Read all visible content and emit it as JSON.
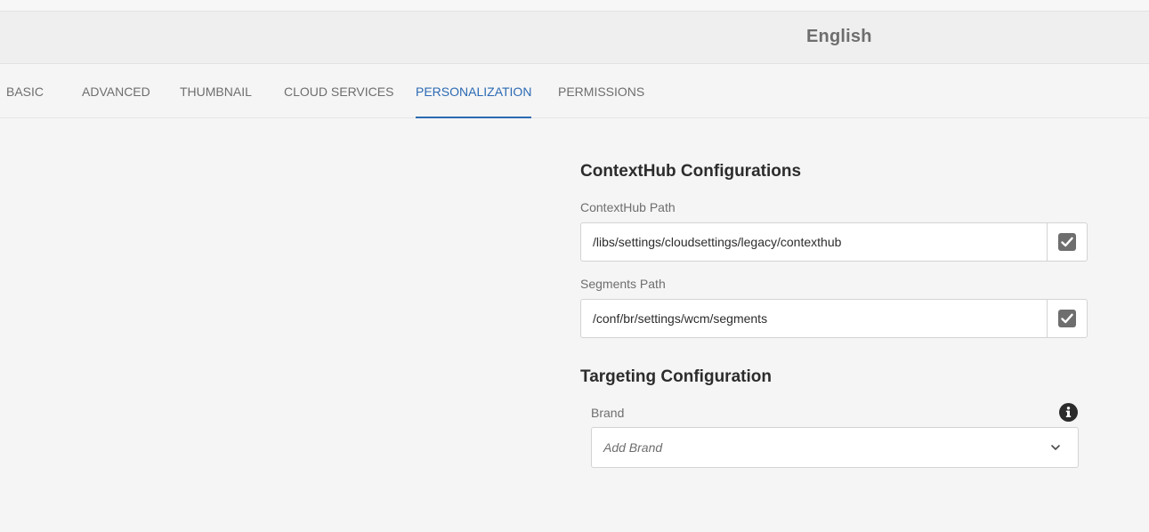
{
  "header": {
    "title": "English"
  },
  "tabs": [
    {
      "label": "BASIC",
      "active": false
    },
    {
      "label": "ADVANCED",
      "active": false
    },
    {
      "label": "THUMBNAIL",
      "active": false
    },
    {
      "label": "CLOUD SERVICES",
      "active": false
    },
    {
      "label": "PERSONALIZATION",
      "active": true
    },
    {
      "label": "PERMISSIONS",
      "active": false
    }
  ],
  "contexthub": {
    "section_title": "ContextHub Configurations",
    "path_label": "ContextHub Path",
    "path_value": "/libs/settings/cloudsettings/legacy/contexthub",
    "path_inherit_icon": "checkbox-checked-icon",
    "segments_label": "Segments Path",
    "segments_value": "/conf/br/settings/wcm/segments",
    "segments_inherit_icon": "checkbox-checked-icon"
  },
  "targeting": {
    "section_title": "Targeting Configuration",
    "brand_label": "Brand",
    "brand_placeholder": "Add Brand",
    "info_icon": "info-icon",
    "dropdown_icon": "chevron-down-icon"
  },
  "colors": {
    "accent": "#2c6ab3",
    "background": "#f5f5f5",
    "titlebar": "#efefef"
  }
}
